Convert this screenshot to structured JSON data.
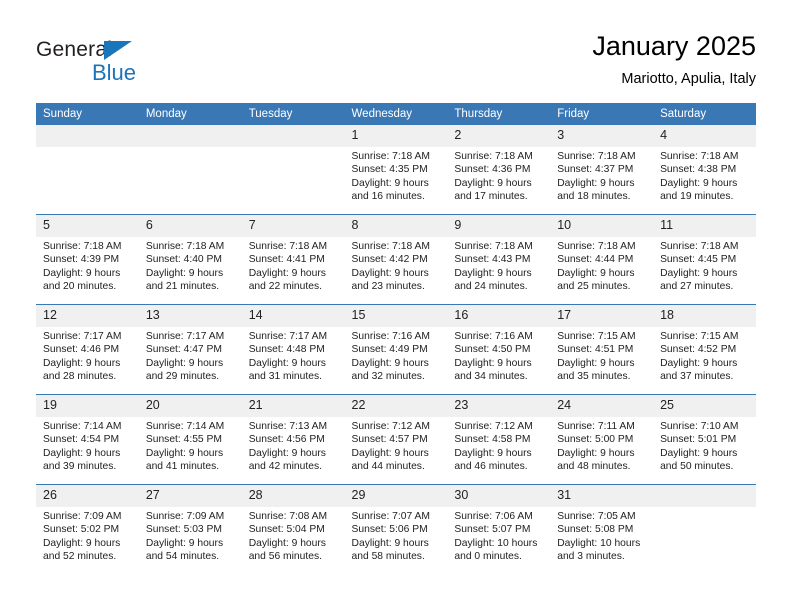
{
  "brand": {
    "name_top": "General",
    "name_bottom": "Blue",
    "accent_color": "#1b75bb"
  },
  "header": {
    "title": "January 2025",
    "subtitle": "Mariotto, Apulia, Italy"
  },
  "colors": {
    "header_row": "#3a78b5",
    "daynum_band": "#f0f0f0",
    "text": "#222222"
  },
  "weekday_headers": [
    "Sunday",
    "Monday",
    "Tuesday",
    "Wednesday",
    "Thursday",
    "Friday",
    "Saturday"
  ],
  "weeks": [
    [
      {
        "day": "",
        "empty": true
      },
      {
        "day": "",
        "empty": true
      },
      {
        "day": "",
        "empty": true
      },
      {
        "day": "1",
        "sunrise": "Sunrise: 7:18 AM",
        "sunset": "Sunset: 4:35 PM",
        "daylight1": "Daylight: 9 hours",
        "daylight2": "and 16 minutes."
      },
      {
        "day": "2",
        "sunrise": "Sunrise: 7:18 AM",
        "sunset": "Sunset: 4:36 PM",
        "daylight1": "Daylight: 9 hours",
        "daylight2": "and 17 minutes."
      },
      {
        "day": "3",
        "sunrise": "Sunrise: 7:18 AM",
        "sunset": "Sunset: 4:37 PM",
        "daylight1": "Daylight: 9 hours",
        "daylight2": "and 18 minutes."
      },
      {
        "day": "4",
        "sunrise": "Sunrise: 7:18 AM",
        "sunset": "Sunset: 4:38 PM",
        "daylight1": "Daylight: 9 hours",
        "daylight2": "and 19 minutes."
      }
    ],
    [
      {
        "day": "5",
        "sunrise": "Sunrise: 7:18 AM",
        "sunset": "Sunset: 4:39 PM",
        "daylight1": "Daylight: 9 hours",
        "daylight2": "and 20 minutes."
      },
      {
        "day": "6",
        "sunrise": "Sunrise: 7:18 AM",
        "sunset": "Sunset: 4:40 PM",
        "daylight1": "Daylight: 9 hours",
        "daylight2": "and 21 minutes."
      },
      {
        "day": "7",
        "sunrise": "Sunrise: 7:18 AM",
        "sunset": "Sunset: 4:41 PM",
        "daylight1": "Daylight: 9 hours",
        "daylight2": "and 22 minutes."
      },
      {
        "day": "8",
        "sunrise": "Sunrise: 7:18 AM",
        "sunset": "Sunset: 4:42 PM",
        "daylight1": "Daylight: 9 hours",
        "daylight2": "and 23 minutes."
      },
      {
        "day": "9",
        "sunrise": "Sunrise: 7:18 AM",
        "sunset": "Sunset: 4:43 PM",
        "daylight1": "Daylight: 9 hours",
        "daylight2": "and 24 minutes."
      },
      {
        "day": "10",
        "sunrise": "Sunrise: 7:18 AM",
        "sunset": "Sunset: 4:44 PM",
        "daylight1": "Daylight: 9 hours",
        "daylight2": "and 25 minutes."
      },
      {
        "day": "11",
        "sunrise": "Sunrise: 7:18 AM",
        "sunset": "Sunset: 4:45 PM",
        "daylight1": "Daylight: 9 hours",
        "daylight2": "and 27 minutes."
      }
    ],
    [
      {
        "day": "12",
        "sunrise": "Sunrise: 7:17 AM",
        "sunset": "Sunset: 4:46 PM",
        "daylight1": "Daylight: 9 hours",
        "daylight2": "and 28 minutes."
      },
      {
        "day": "13",
        "sunrise": "Sunrise: 7:17 AM",
        "sunset": "Sunset: 4:47 PM",
        "daylight1": "Daylight: 9 hours",
        "daylight2": "and 29 minutes."
      },
      {
        "day": "14",
        "sunrise": "Sunrise: 7:17 AM",
        "sunset": "Sunset: 4:48 PM",
        "daylight1": "Daylight: 9 hours",
        "daylight2": "and 31 minutes."
      },
      {
        "day": "15",
        "sunrise": "Sunrise: 7:16 AM",
        "sunset": "Sunset: 4:49 PM",
        "daylight1": "Daylight: 9 hours",
        "daylight2": "and 32 minutes."
      },
      {
        "day": "16",
        "sunrise": "Sunrise: 7:16 AM",
        "sunset": "Sunset: 4:50 PM",
        "daylight1": "Daylight: 9 hours",
        "daylight2": "and 34 minutes."
      },
      {
        "day": "17",
        "sunrise": "Sunrise: 7:15 AM",
        "sunset": "Sunset: 4:51 PM",
        "daylight1": "Daylight: 9 hours",
        "daylight2": "and 35 minutes."
      },
      {
        "day": "18",
        "sunrise": "Sunrise: 7:15 AM",
        "sunset": "Sunset: 4:52 PM",
        "daylight1": "Daylight: 9 hours",
        "daylight2": "and 37 minutes."
      }
    ],
    [
      {
        "day": "19",
        "sunrise": "Sunrise: 7:14 AM",
        "sunset": "Sunset: 4:54 PM",
        "daylight1": "Daylight: 9 hours",
        "daylight2": "and 39 minutes."
      },
      {
        "day": "20",
        "sunrise": "Sunrise: 7:14 AM",
        "sunset": "Sunset: 4:55 PM",
        "daylight1": "Daylight: 9 hours",
        "daylight2": "and 41 minutes."
      },
      {
        "day": "21",
        "sunrise": "Sunrise: 7:13 AM",
        "sunset": "Sunset: 4:56 PM",
        "daylight1": "Daylight: 9 hours",
        "daylight2": "and 42 minutes."
      },
      {
        "day": "22",
        "sunrise": "Sunrise: 7:12 AM",
        "sunset": "Sunset: 4:57 PM",
        "daylight1": "Daylight: 9 hours",
        "daylight2": "and 44 minutes."
      },
      {
        "day": "23",
        "sunrise": "Sunrise: 7:12 AM",
        "sunset": "Sunset: 4:58 PM",
        "daylight1": "Daylight: 9 hours",
        "daylight2": "and 46 minutes."
      },
      {
        "day": "24",
        "sunrise": "Sunrise: 7:11 AM",
        "sunset": "Sunset: 5:00 PM",
        "daylight1": "Daylight: 9 hours",
        "daylight2": "and 48 minutes."
      },
      {
        "day": "25",
        "sunrise": "Sunrise: 7:10 AM",
        "sunset": "Sunset: 5:01 PM",
        "daylight1": "Daylight: 9 hours",
        "daylight2": "and 50 minutes."
      }
    ],
    [
      {
        "day": "26",
        "sunrise": "Sunrise: 7:09 AM",
        "sunset": "Sunset: 5:02 PM",
        "daylight1": "Daylight: 9 hours",
        "daylight2": "and 52 minutes."
      },
      {
        "day": "27",
        "sunrise": "Sunrise: 7:09 AM",
        "sunset": "Sunset: 5:03 PM",
        "daylight1": "Daylight: 9 hours",
        "daylight2": "and 54 minutes."
      },
      {
        "day": "28",
        "sunrise": "Sunrise: 7:08 AM",
        "sunset": "Sunset: 5:04 PM",
        "daylight1": "Daylight: 9 hours",
        "daylight2": "and 56 minutes."
      },
      {
        "day": "29",
        "sunrise": "Sunrise: 7:07 AM",
        "sunset": "Sunset: 5:06 PM",
        "daylight1": "Daylight: 9 hours",
        "daylight2": "and 58 minutes."
      },
      {
        "day": "30",
        "sunrise": "Sunrise: 7:06 AM",
        "sunset": "Sunset: 5:07 PM",
        "daylight1": "Daylight: 10 hours",
        "daylight2": "and 0 minutes."
      },
      {
        "day": "31",
        "sunrise": "Sunrise: 7:05 AM",
        "sunset": "Sunset: 5:08 PM",
        "daylight1": "Daylight: 10 hours",
        "daylight2": "and 3 minutes."
      },
      {
        "day": "",
        "empty": true
      }
    ]
  ]
}
